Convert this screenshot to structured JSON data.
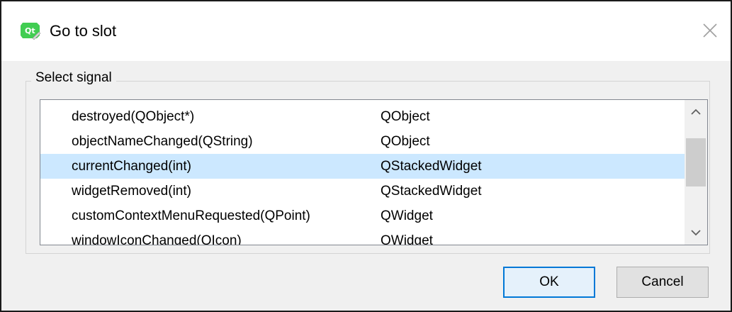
{
  "window": {
    "title": "Go to slot",
    "icon": "qt-designer-icon",
    "accent_color": "#0078d7"
  },
  "group": {
    "label": "Select signal"
  },
  "signals": [
    {
      "signal": "destroyed(QObject*)",
      "class": "QObject",
      "selected": false
    },
    {
      "signal": "objectNameChanged(QString)",
      "class": "QObject",
      "selected": false
    },
    {
      "signal": "currentChanged(int)",
      "class": "QStackedWidget",
      "selected": true
    },
    {
      "signal": "widgetRemoved(int)",
      "class": "QStackedWidget",
      "selected": false
    },
    {
      "signal": "customContextMenuRequested(QPoint)",
      "class": "QWidget",
      "selected": false
    },
    {
      "signal": "windowIconChanged(QIcon)",
      "class": "QWidget",
      "selected": false
    }
  ],
  "selection_color": "#cce8ff",
  "buttons": {
    "ok": "OK",
    "cancel": "Cancel"
  }
}
